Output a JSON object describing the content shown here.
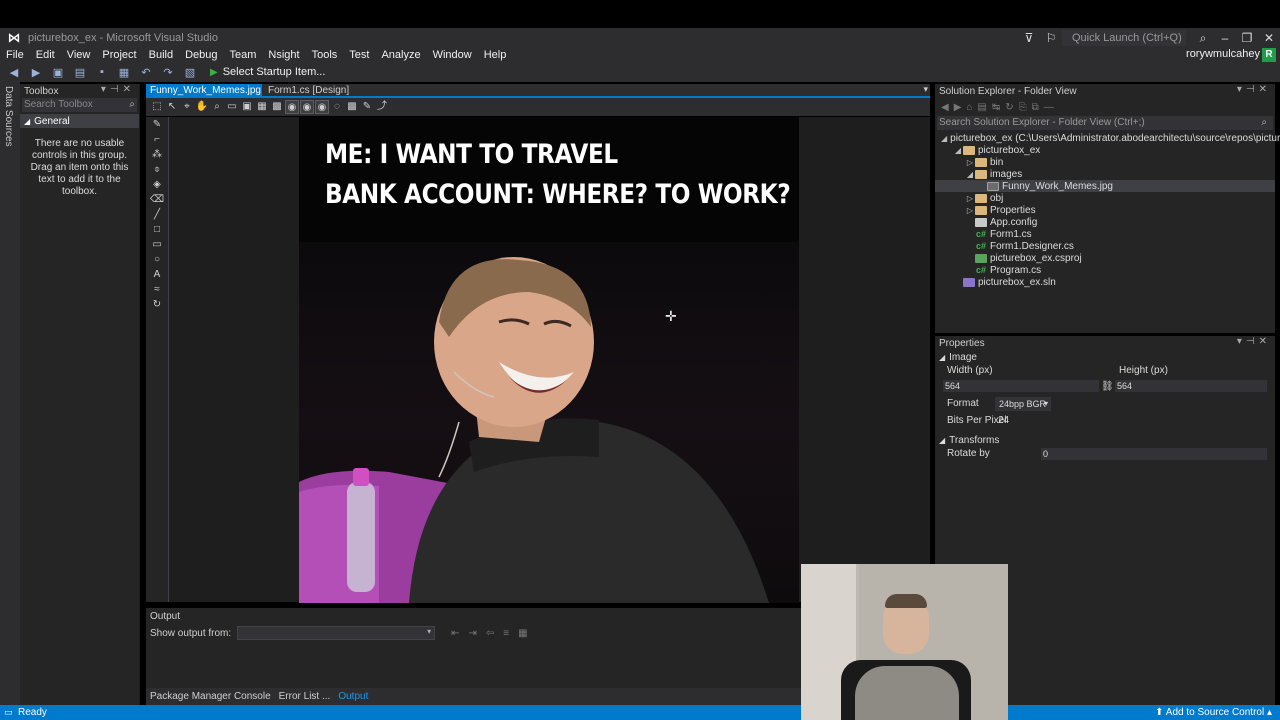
{
  "window": {
    "title": "picturebox_ex - Microsoft Visual Studio",
    "quick_launch": "Quick Launch (Ctrl+Q)"
  },
  "menu": {
    "items": [
      "File",
      "Edit",
      "View",
      "Project",
      "Build",
      "Debug",
      "Team",
      "Nsight",
      "Tools",
      "Test",
      "Analyze",
      "Window",
      "Help"
    ],
    "account": "rorywmulcahey",
    "account_badge": "R"
  },
  "toolbar": {
    "start_label": "Select Startup Item..."
  },
  "left_strip": {
    "data_sources": "Data Sources"
  },
  "toolbox": {
    "title": "Toolbox",
    "search_placeholder": "Search Toolbox",
    "group": "General",
    "empty_message": "There are no usable controls in this group. Drag an item onto this text to add it to the toolbox."
  },
  "doc_tabs": {
    "active": "Funny_Work_Memes.jpg",
    "inactive": "Form1.cs [Design]"
  },
  "meme": {
    "line1": "ME: I WANT TO TRAVEL",
    "line2": "BANK ACCOUNT: WHERE? TO WORK?"
  },
  "output": {
    "title": "Output",
    "show_from_label": "Show output from:"
  },
  "bottom_tabs": [
    "Package Manager Console",
    "Error List ...",
    "Output"
  ],
  "solution_explorer": {
    "title": "Solution Explorer - Folder View",
    "search_placeholder": "Search Solution Explorer - Folder View (Ctrl+;)",
    "tree": [
      {
        "label": "picturebox_ex (C:\\Users\\Administrator.abodearchitectu\\source\\repos\\picturebox_ex)",
        "icon": "folder",
        "depth": 0,
        "caret": "◢"
      },
      {
        "label": "picturebox_ex",
        "icon": "folder",
        "depth": 1,
        "caret": "◢"
      },
      {
        "label": "bin",
        "icon": "folder",
        "depth": 2,
        "caret": "▷"
      },
      {
        "label": "images",
        "icon": "folder",
        "depth": 2,
        "caret": "◢"
      },
      {
        "label": "Funny_Work_Memes.jpg",
        "icon": "img",
        "depth": 3,
        "caret": "",
        "selected": true
      },
      {
        "label": "obj",
        "icon": "folder",
        "depth": 2,
        "caret": "▷"
      },
      {
        "label": "Properties",
        "icon": "folder",
        "depth": 2,
        "caret": "▷"
      },
      {
        "label": "App.config",
        "icon": "cfg",
        "depth": 2,
        "caret": ""
      },
      {
        "label": "Form1.cs",
        "icon": "cs",
        "depth": 2,
        "caret": ""
      },
      {
        "label": "Form1.Designer.cs",
        "icon": "cs",
        "depth": 2,
        "caret": ""
      },
      {
        "label": "picturebox_ex.csproj",
        "icon": "proj",
        "depth": 2,
        "caret": ""
      },
      {
        "label": "Program.cs",
        "icon": "cs",
        "depth": 2,
        "caret": ""
      },
      {
        "label": "picturebox_ex.sln",
        "icon": "sol",
        "depth": 1,
        "caret": ""
      }
    ]
  },
  "properties": {
    "title": "Properties",
    "image_category": "Image",
    "width_label": "Width (px)",
    "width_value": "564",
    "height_label": "Height (px)",
    "height_value": "564",
    "format_label": "Format",
    "format_value": "24bpp BGR",
    "bpp_label": "Bits Per Pixel",
    "bpp_value": "24",
    "transforms_category": "Transforms",
    "rotate_label": "Rotate by",
    "rotate_value": "0"
  },
  "status": {
    "ready": "Ready",
    "source_control": "Add to Source Control"
  },
  "colors": {
    "accent": "#007acc",
    "chrome": "#2d2d30",
    "panel": "#252526",
    "editor": "#1e1e1e"
  }
}
